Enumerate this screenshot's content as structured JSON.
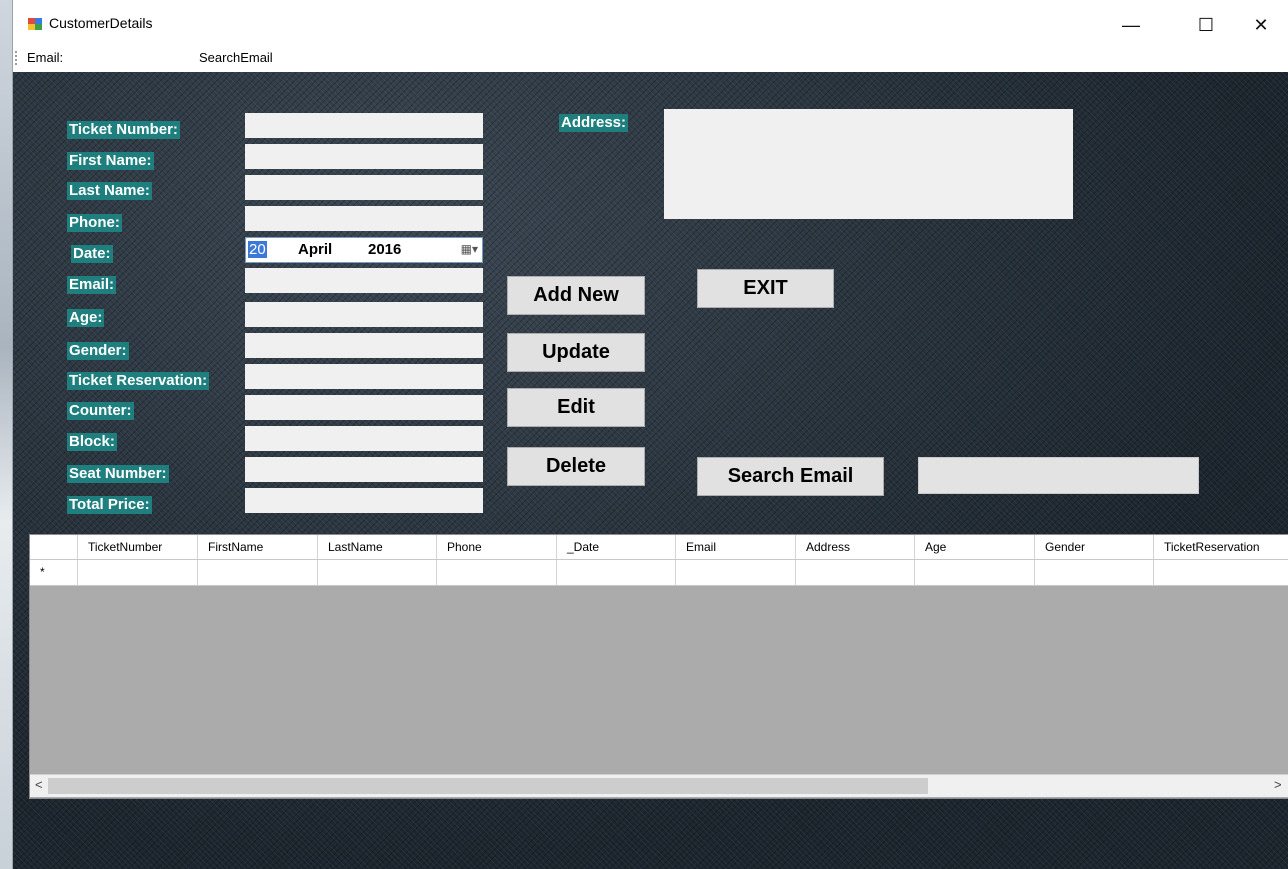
{
  "window": {
    "title": "CustomerDetails",
    "minimize": "—",
    "maximize": "☐",
    "close": "✕"
  },
  "menubar": {
    "email_label": "Email:",
    "search_email": "SearchEmail"
  },
  "form": {
    "labels": {
      "ticket_number": "Ticket Number:",
      "first_name": "First Name:",
      "last_name": "Last Name:",
      "phone": "Phone:",
      "date": "Date:",
      "email": "Email:",
      "age": "Age:",
      "gender": "Gender:",
      "ticket_reservation": "Ticket Reservation:",
      "counter": "Counter:",
      "block": "Block:",
      "seat_number": "Seat Number:",
      "total_price": "Total Price:",
      "address": "Address:"
    },
    "date": {
      "day": "20",
      "month": "April",
      "year": "2016",
      "calendar_icon": "▦▾"
    },
    "buttons": {
      "add_new": "Add New",
      "update": "Update",
      "edit": "Edit",
      "delete": "Delete",
      "exit": "EXIT",
      "search_email": "Search Email"
    }
  },
  "grid": {
    "columns": [
      "TicketNumber",
      "FirstName",
      "LastName",
      "Phone",
      "_Date",
      "Email",
      "Address",
      "Age",
      "Gender",
      "TicketReservation"
    ],
    "new_row_marker": "*",
    "scroll_left": "<",
    "scroll_right": ">"
  }
}
